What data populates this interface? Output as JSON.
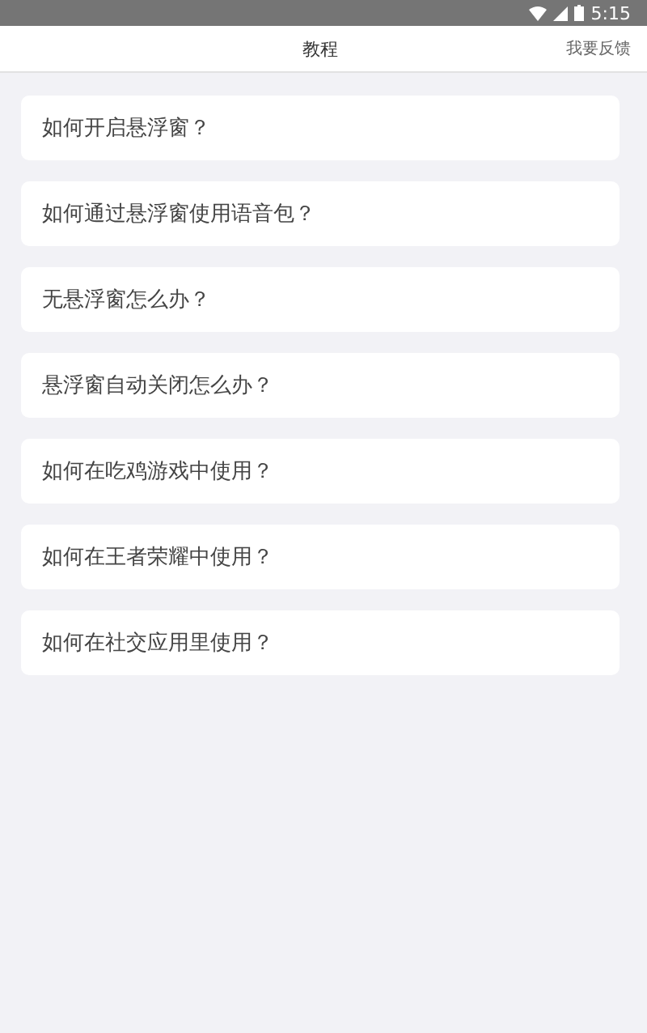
{
  "status_bar": {
    "time": "5:15"
  },
  "header": {
    "title": "教程",
    "action": "我要反馈"
  },
  "items": [
    {
      "label": "如何开启悬浮窗？"
    },
    {
      "label": "如何通过悬浮窗使用语音包？"
    },
    {
      "label": "无悬浮窗怎么办？"
    },
    {
      "label": "悬浮窗自动关闭怎么办？"
    },
    {
      "label": "如何在吃鸡游戏中使用？"
    },
    {
      "label": "如何在王者荣耀中使用？"
    },
    {
      "label": "如何在社交应用里使用？"
    }
  ]
}
